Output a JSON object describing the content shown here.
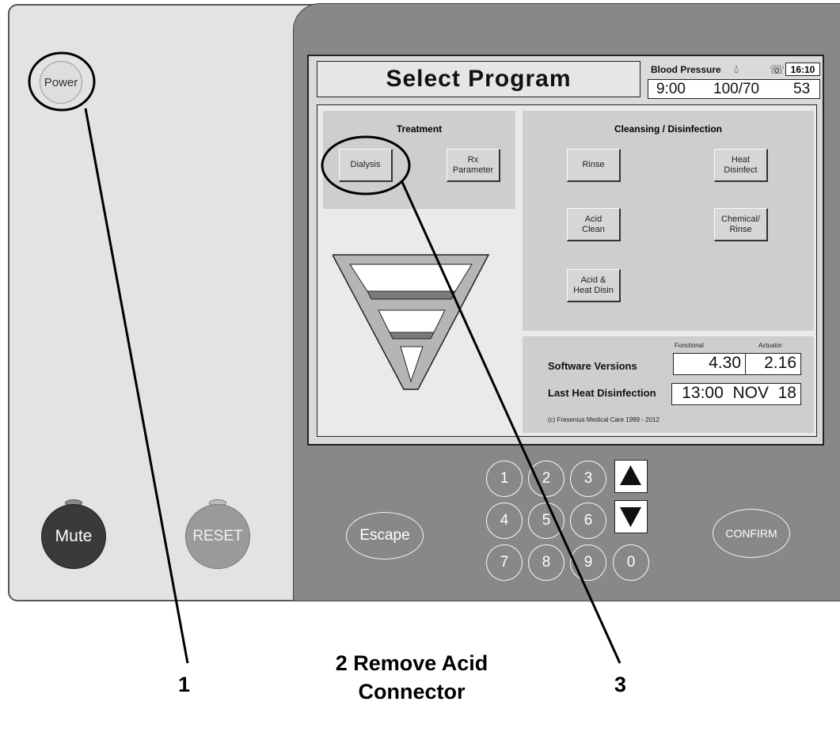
{
  "panel": {
    "power_label": "Power",
    "mute_label": "Mute",
    "reset_label": "RESET"
  },
  "screen": {
    "title": "Select Program",
    "blood_pressure_label": "Blood Pressure",
    "clock": "16:10",
    "bp_time": "9:00",
    "bp_value": "100/70",
    "pulse": "53",
    "treatment": {
      "title": "Treatment",
      "buttons": [
        "Dialysis",
        "Rx\nParameter"
      ]
    },
    "cleansing": {
      "title": "Cleansing / Disinfection",
      "buttons": [
        "Rinse",
        "Heat\nDisinfect",
        "Acid\nClean",
        "Chemical/\nRinse",
        "Acid &\nHeat Disin"
      ]
    },
    "software": {
      "label": "Software Versions",
      "functional_label": "Functional",
      "actuator_label": "Actuator",
      "functional": "4.30",
      "actuator": "2.16",
      "last_heat_label": "Last Heat Disinfection",
      "last_heat": "13:00  NOV  18",
      "copyright": "(c) Fresenius Medical Care 1999 - 2012"
    }
  },
  "keypad": {
    "keys": [
      "1",
      "2",
      "3",
      "4",
      "5",
      "6",
      "7",
      "8",
      "9",
      "0"
    ],
    "escape_label": "Escape",
    "confirm_label": "CONFIRM",
    "up_icon": "arrow-up-icon",
    "down_icon": "arrow-down-icon"
  },
  "annotations": {
    "callout_1": "1",
    "callout_2_line1": "2 Remove Acid",
    "callout_2_line2": "Connector",
    "callout_3": "3"
  }
}
